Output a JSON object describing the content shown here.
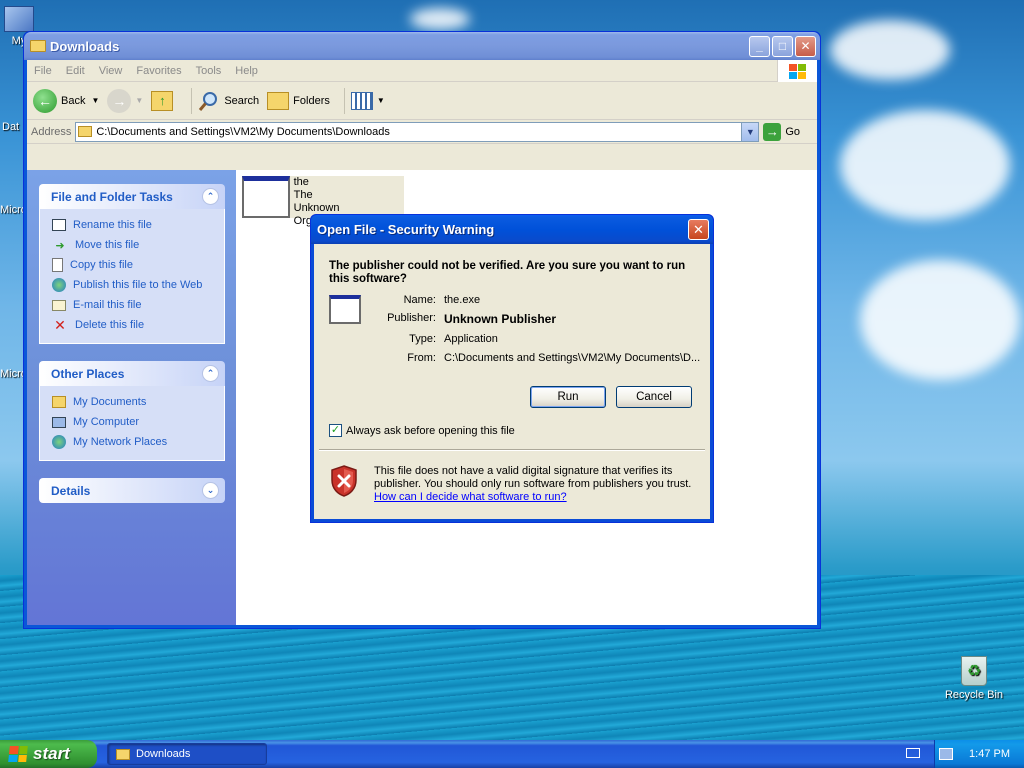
{
  "desktop": {
    "icons": [
      {
        "label": "My",
        "name": "my-computer-desktop-icon"
      },
      {
        "label": "Dat",
        "name": "data-desktop-icon"
      },
      {
        "label": "Micro",
        "name": "microsoft-desktop-icon-1"
      },
      {
        "label": "Micro",
        "name": "microsoft-desktop-icon-2"
      }
    ],
    "recycle_bin": "Recycle Bin"
  },
  "explorer": {
    "title": "Downloads",
    "menu": [
      "File",
      "Edit",
      "View",
      "Favorites",
      "Tools",
      "Help"
    ],
    "toolbar": {
      "back": "Back",
      "search": "Search",
      "folders": "Folders"
    },
    "address": {
      "label": "Address",
      "value": "C:\\Documents and Settings\\VM2\\My Documents\\Downloads",
      "go": "Go"
    },
    "file_folder_tasks": {
      "title": "File and Folder Tasks",
      "items": [
        "Rename this file",
        "Move this file",
        "Copy this file",
        "Publish this file to the Web",
        "E-mail this file",
        "Delete this file"
      ]
    },
    "other_places": {
      "title": "Other Places",
      "items": [
        "My Documents",
        "My Computer",
        "My Network Places"
      ]
    },
    "details": {
      "title": "Details"
    },
    "file": {
      "line1": "the",
      "line2": "The",
      "line3": "Unknown Organization"
    }
  },
  "dialog": {
    "title": "Open File - Security Warning",
    "question": "The publisher could not be verified.  Are you sure you want to run this software?",
    "fields": {
      "name_label": "Name:",
      "name_value": "the.exe",
      "publisher_label": "Publisher:",
      "publisher_value": "Unknown Publisher",
      "type_label": "Type:",
      "type_value": "Application",
      "from_label": "From:",
      "from_value": "C:\\Documents and Settings\\VM2\\My Documents\\D..."
    },
    "run_label": "Run",
    "cancel_label": "Cancel",
    "checkbox_label": "Always ask before opening this file",
    "checkbox_checked": true,
    "info_text": "This file does not have a valid digital signature that verifies its publisher.  You should only run software from publishers you trust.",
    "info_link": "How can I decide what software to run?"
  },
  "taskbar": {
    "start_label": "start",
    "task_button": "Downloads",
    "clock": "1:47 PM"
  }
}
